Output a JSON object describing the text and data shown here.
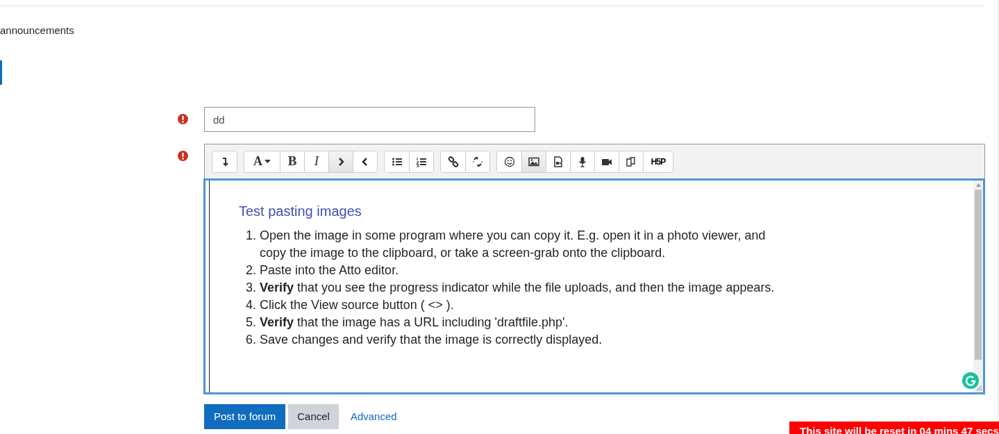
{
  "breadcrumb_tail": "announcements",
  "subject_field": {
    "value": "dd",
    "required": true
  },
  "editor": {
    "required": true,
    "toolbar_groups": [
      [
        {
          "kind": "collapse",
          "highlighted": false
        }
      ],
      [
        {
          "kind": "font",
          "label": "A",
          "dropdown": true,
          "highlighted": false
        },
        {
          "kind": "bold",
          "label": "B",
          "highlighted": false
        },
        {
          "kind": "italic",
          "label": "I",
          "highlighted": false
        },
        {
          "kind": "indent",
          "highlighted": true
        },
        {
          "kind": "outdent",
          "highlighted": false
        }
      ],
      [
        {
          "kind": "bullets",
          "highlighted": false
        },
        {
          "kind": "numbers",
          "highlighted": false
        }
      ],
      [
        {
          "kind": "link",
          "highlighted": false
        },
        {
          "kind": "unlink",
          "highlighted": false
        }
      ],
      [
        {
          "kind": "emoji",
          "highlighted": false
        },
        {
          "kind": "image",
          "highlighted": true
        },
        {
          "kind": "media",
          "highlighted": false
        },
        {
          "kind": "audio",
          "highlighted": false
        },
        {
          "kind": "video",
          "highlighted": false
        },
        {
          "kind": "files",
          "highlighted": false
        },
        {
          "kind": "h5p",
          "label": "H5P",
          "highlighted": false
        }
      ]
    ],
    "heading": "Test pasting images",
    "steps": [
      {
        "number": "1.",
        "text": "Open the image in some program where you can copy it. E.g. open it in a photo viewer, and copy the image to the clipboard, or take a screen-grab onto the clipboard."
      },
      {
        "number": "2.",
        "text": "Paste into the Atto editor."
      },
      {
        "number": "3.",
        "text": "**Verify** that you see the progress indicator while the file uploads, and then the image appears."
      },
      {
        "number": "4.",
        "text": "Click the View source button ( <> )."
      },
      {
        "number": "5.",
        "text": "**Verify** that the image has a URL including 'draftfile.php'."
      },
      {
        "number": "6.",
        "text": "Save changes and verify that the image is correctly displayed."
      }
    ]
  },
  "buttons": [
    {
      "kind": "primary",
      "label": "Post to forum"
    },
    {
      "kind": "secondary",
      "label": "Cancel"
    },
    {
      "kind": "link",
      "label": "Advanced"
    }
  ],
  "reset_banner": "This site will be reset in 04 mins 47 secs"
}
